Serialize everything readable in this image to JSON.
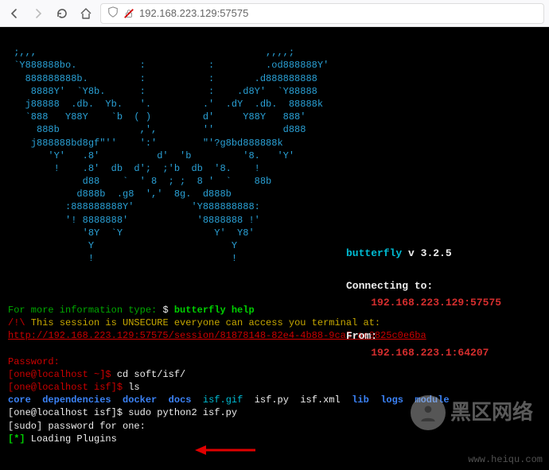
{
  "browser": {
    "url": "192.168.223.129:57575",
    "back": "←",
    "forward": "→",
    "reload": "⟳",
    "home": "⌂",
    "shield": "ⓘ"
  },
  "ascii_art": " ;,,,                                        ,,,,;\n `Y888888bo.           :           :         .od888888Y'\n   888888888b.         :           :       .d888888888\n    8888Y'  `Y8b.      :           :    .d8Y'  `Y88888\n   j88888  .db.  Yb.   '.         .'  .dY  .db.  88888k\n   `888   Y88Y    `b  ( )         d'     Y88Y   888'\n     888b              ,',        ''            d888\n    j888888bd8gf\"''    ':'        \"'?g8bd888888k\n       'Y'   .8'          d'  'b         '8.   'Y'\n        !    .8'  db  d';  ;'b  db  '8.    !\n             d88    `  ' 8  ; ;  8 '  `    88b\n            d888b  .g8  ','  8g.  d888b\n          :888888888Y'          'Y888888888:\n          '! 8888888'            '8888888 !'\n             '8Y  `Y                Y'  Y8'\n              Y                        Y\n              !                        !",
  "side": {
    "name_label": "butterfly",
    "v": "v",
    "version": "3.2.5",
    "connecting": "Connecting to:",
    "conn_addr": "192.168.223.129:57575",
    "from": "From:",
    "from_addr": "192.168.223.1:64207"
  },
  "info": {
    "line1a": "For more information type: ",
    "dollar": "$ ",
    "help_cmd": "butterfly help",
    "warn_prefix": "/!\\",
    "warn_text": " This session is UNSECURE everyone can access you terminal at:",
    "url": "http://192.168.223.129:57575/session/81878148-82e4-4b88-9ca5-ae0825c0e6ba"
  },
  "shell": {
    "pwd_label": "Password:",
    "prompt1": "[one@localhost ~]$ ",
    "cmd1": "cd soft/isf/",
    "prompt2": "[one@localhost isf]$ ",
    "cmd2": "ls",
    "dirlist": "core  dependencies  docker  docs  isf.gif  isf.py  isf.xml  lib  logs  module",
    "dirlist_items": [
      {
        "t": "core",
        "c": "blueb"
      },
      {
        "t": "  "
      },
      {
        "t": "dependencies",
        "c": "blueb"
      },
      {
        "t": "  "
      },
      {
        "t": "docker",
        "c": "blueb"
      },
      {
        "t": "  "
      },
      {
        "t": "docs",
        "c": "blueb"
      },
      {
        "t": "  "
      },
      {
        "t": "isf.gif",
        "c": "cyan"
      },
      {
        "t": "  "
      },
      {
        "t": "isf.py",
        "c": "white"
      },
      {
        "t": "  "
      },
      {
        "t": "isf.xml",
        "c": "white"
      },
      {
        "t": "  "
      },
      {
        "t": "lib",
        "c": "blueb"
      },
      {
        "t": "  "
      },
      {
        "t": "logs",
        "c": "blueb"
      },
      {
        "t": "  "
      },
      {
        "t": "module",
        "c": "blueb"
      }
    ],
    "prompt3": "[one@localhost isf]$ ",
    "cmd3": "sudo python2 isf.py",
    "sudo_line": "[sudo] password for one:",
    "load_prefix": "[*]",
    "load_text": " Loading Plugins"
  },
  "watermark": {
    "text1": "黑区网络",
    "text2": "www.heiqu.com"
  }
}
